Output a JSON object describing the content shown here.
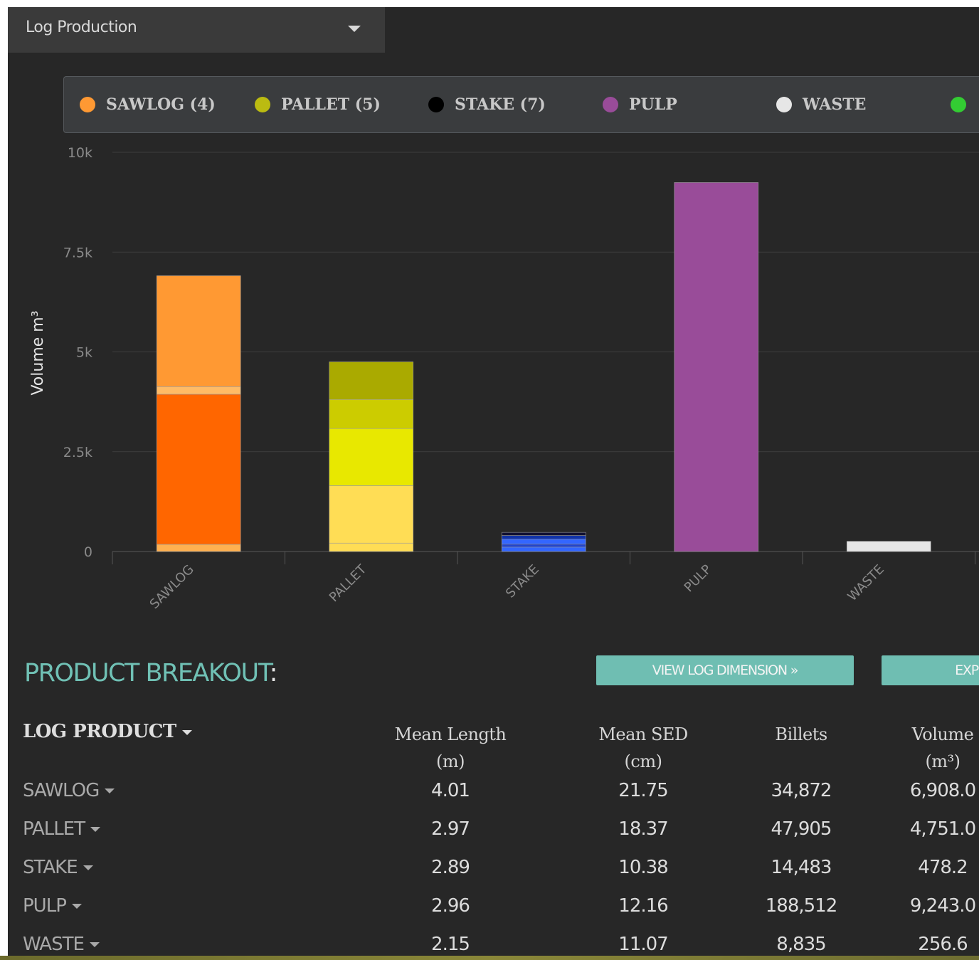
{
  "dropdown": {
    "label": "Log Production"
  },
  "colors": {
    "sawlog": "#ff9933",
    "pallet": "#bbbb11",
    "stake": "#000000",
    "pulp": "#994c99",
    "waste": "#e6e6e6",
    "other": "#33cc33",
    "accent": "#6fbeb2"
  },
  "legend": [
    {
      "label": "SAWLOG (4)",
      "color": "#ff9933"
    },
    {
      "label": "PALLET (5)",
      "color": "#bbbb11"
    },
    {
      "label": "STAKE (7)",
      "color": "#000000"
    },
    {
      "label": "PULP",
      "color": "#994c99"
    },
    {
      "label": "WASTE",
      "color": "#e6e6e6"
    },
    {
      "label": "",
      "color": "#33cc33"
    }
  ],
  "chart_data": {
    "type": "bar",
    "stacked": true,
    "ylabel": "Volume m³",
    "xlabel": "",
    "ylim": [
      0,
      10000
    ],
    "yticks": [
      "0",
      "2.5k",
      "5k",
      "7.5k",
      "10k"
    ],
    "categories": [
      "SAWLOG",
      "PALLET",
      "STAKE",
      "PULP",
      "WASTE"
    ],
    "stacks": [
      {
        "category": "SAWLOG",
        "segments": [
          {
            "value": 180,
            "color": "#ffb050"
          },
          {
            "value": 3760,
            "color": "#ff6600"
          },
          {
            "value": 190,
            "color": "#ffbb66"
          },
          {
            "value": 2778,
            "color": "#ff9933"
          }
        ]
      },
      {
        "category": "PALLET",
        "segments": [
          {
            "value": 210,
            "color": "#ffdd55"
          },
          {
            "value": 1440,
            "color": "#ffdd55"
          },
          {
            "value": 1430,
            "color": "#e8e800"
          },
          {
            "value": 730,
            "color": "#cccc00"
          },
          {
            "value": 941,
            "color": "#aaaa00"
          }
        ]
      },
      {
        "category": "STAKE",
        "segments": [
          {
            "value": 110,
            "color": "#3366ff"
          },
          {
            "value": 80,
            "color": "#2244cc"
          },
          {
            "value": 120,
            "color": "#3366ff"
          },
          {
            "value": 90,
            "color": "#1133aa"
          },
          {
            "value": 78.2,
            "color": "#111133"
          }
        ]
      },
      {
        "category": "PULP",
        "segments": [
          {
            "value": 9243,
            "color": "#994c99"
          }
        ]
      },
      {
        "category": "WASTE",
        "segments": [
          {
            "value": 256.6,
            "color": "#e6e6e6"
          }
        ]
      }
    ]
  },
  "breakout": {
    "title": "PRODUCT BREAKOUT",
    "colon": ":",
    "view_button": "VIEW LOG DIMENSION »",
    "export_button": "EXP",
    "headers": {
      "product": "LOG PRODUCT",
      "mean_length": [
        "Mean Length",
        "(m)"
      ],
      "mean_sed": [
        "Mean SED",
        "(cm)"
      ],
      "billets": "Billets",
      "volume": [
        "Volume",
        "(m³)"
      ]
    },
    "rows": [
      {
        "name": "SAWLOG",
        "mean_length": "4.01",
        "mean_sed": "21.75",
        "billets": "34,872",
        "volume": "6,908.0"
      },
      {
        "name": "PALLET",
        "mean_length": "2.97",
        "mean_sed": "18.37",
        "billets": "47,905",
        "volume": "4,751.0"
      },
      {
        "name": "STAKE",
        "mean_length": "2.89",
        "mean_sed": "10.38",
        "billets": "14,483",
        "volume": "478.2"
      },
      {
        "name": "PULP",
        "mean_length": "2.96",
        "mean_sed": "12.16",
        "billets": "188,512",
        "volume": "9,243.0"
      },
      {
        "name": "WASTE",
        "mean_length": "2.15",
        "mean_sed": "11.07",
        "billets": "8,835",
        "volume": "256.6"
      }
    ]
  }
}
